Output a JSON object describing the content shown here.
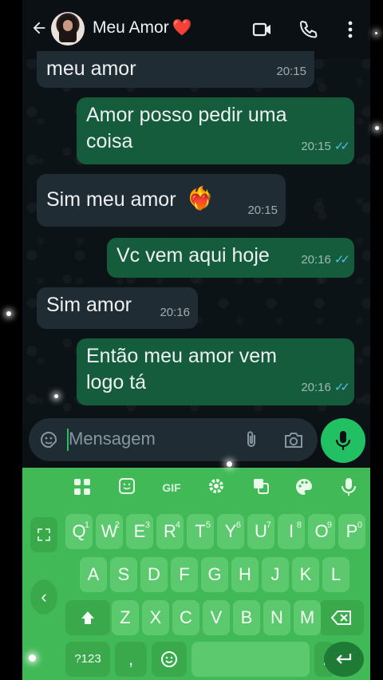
{
  "header": {
    "contact_name": "Meu Amor",
    "contact_emoji": "❤️",
    "icons": [
      "back-arrow-icon",
      "video-call-icon",
      "phone-icon",
      "more-icon"
    ]
  },
  "messages": [
    {
      "dir": "in",
      "text": "meu amor",
      "time": "20:15"
    },
    {
      "dir": "out",
      "line1": "Amor posso pedir uma",
      "line2": "coisa",
      "time": "20:15",
      "status": "read"
    },
    {
      "dir": "in",
      "text": "Sim meu amor",
      "emoji": "❤️‍🔥",
      "time": "20:15"
    },
    {
      "dir": "out",
      "text": "Vc vem aqui hoje",
      "time": "20:16",
      "status": "read"
    },
    {
      "dir": "in",
      "text": "Sim amor",
      "time": "20:16"
    },
    {
      "dir": "out",
      "line1": "Então meu amor vem",
      "line2": "logo tá",
      "time": "20:16",
      "status": "read"
    }
  ],
  "composer": {
    "placeholder": "Mensagem"
  },
  "keyboard": {
    "toolbar": [
      "apps-icon",
      "sticker-icon",
      "GIF",
      "settings-icon",
      "translate-icon",
      "palette-icon",
      "mic-icon"
    ],
    "row1": [
      {
        "k": "Q",
        "n": "1"
      },
      {
        "k": "W",
        "n": "2"
      },
      {
        "k": "E",
        "n": "3"
      },
      {
        "k": "R",
        "n": "4"
      },
      {
        "k": "T",
        "n": "5"
      },
      {
        "k": "Y",
        "n": "6"
      },
      {
        "k": "U",
        "n": "7"
      },
      {
        "k": "I",
        "n": "8"
      },
      {
        "k": "O",
        "n": "9"
      },
      {
        "k": "P",
        "n": "0"
      }
    ],
    "row2": [
      "A",
      "S",
      "D",
      "F",
      "G",
      "H",
      "J",
      "K",
      "L"
    ],
    "row3": [
      "Z",
      "X",
      "C",
      "V",
      "B",
      "N",
      "M"
    ],
    "sym_label": "?123",
    "comma": ",",
    "period": "."
  }
}
